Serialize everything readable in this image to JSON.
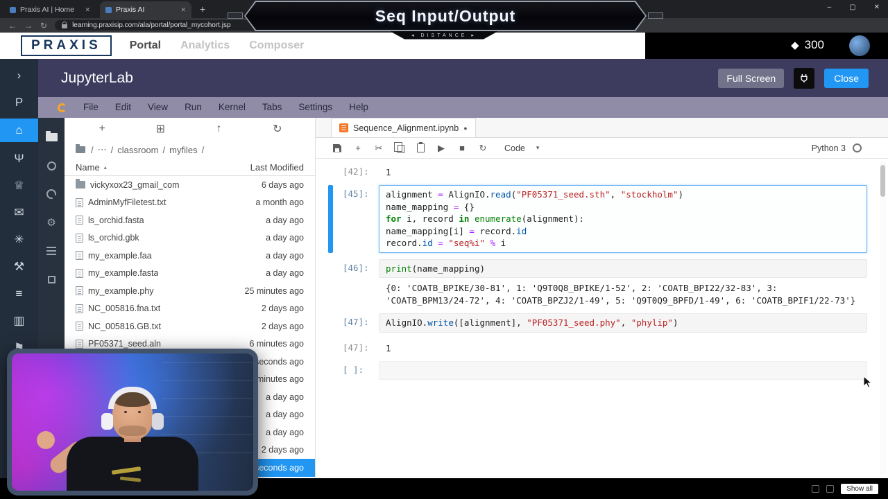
{
  "browser": {
    "tabs": [
      {
        "title": "Praxis AI | Home",
        "close_glyph": "✕"
      },
      {
        "title": "Praxis AI",
        "close_glyph": "✕"
      }
    ],
    "new_tab_glyph": "+",
    "nav": {
      "back": "←",
      "forward": "→",
      "reload": "↻"
    },
    "url": "learning.praxisip.com/ala/portal/portal_mycohort.jsp",
    "window_controls": [
      "–",
      "▢",
      "✕"
    ]
  },
  "stream_overlay": {
    "title": "Seq Input/Output",
    "subtitle": "◂ DISTANCE ▸"
  },
  "praxis": {
    "logo": "PRAXIS",
    "nav": [
      {
        "label": "Portal",
        "active": true
      },
      {
        "label": "Analytics",
        "active": false
      },
      {
        "label": "Composer",
        "active": false
      }
    ],
    "points": "300",
    "points_icon": "◆",
    "rail": [
      {
        "name": "chevron-right",
        "glyph": "›"
      },
      {
        "name": "praxis-p",
        "glyph": "P"
      },
      {
        "name": "home",
        "glyph": "⌂",
        "active": true
      },
      {
        "name": "branch",
        "glyph": "Ψ"
      },
      {
        "name": "trophy",
        "glyph": "♕"
      },
      {
        "name": "mail",
        "glyph": "✉"
      },
      {
        "name": "palette",
        "glyph": "✳"
      },
      {
        "name": "tools",
        "glyph": "⚒"
      },
      {
        "name": "list",
        "glyph": "≡"
      },
      {
        "name": "chart",
        "glyph": "▥"
      },
      {
        "name": "flag",
        "glyph": "⚑"
      },
      {
        "name": "close",
        "glyph": "×"
      }
    ]
  },
  "jupyter": {
    "title": "JupyterLab",
    "fullscreen_label": "Full Screen",
    "close_label": "Close",
    "menu": [
      "File",
      "Edit",
      "View",
      "Run",
      "Kernel",
      "Tabs",
      "Settings",
      "Help"
    ],
    "activity": [
      {
        "name": "file-browser",
        "shape": "folder",
        "active": true
      },
      {
        "name": "running-sessions",
        "shape": "ring"
      },
      {
        "name": "command-palette",
        "shape": "palette"
      },
      {
        "name": "property-inspector",
        "glyph": "⚙"
      },
      {
        "name": "open-tabs",
        "shape": "bars"
      },
      {
        "name": "extension-manager",
        "shape": "square"
      }
    ],
    "filebrowser": {
      "toolbar": [
        {
          "name": "new-launcher",
          "glyph": "+"
        },
        {
          "name": "new-folder",
          "glyph": "⊞"
        },
        {
          "name": "upload",
          "glyph": "↑"
        },
        {
          "name": "refresh",
          "glyph": "↻"
        }
      ],
      "breadcrumb": [
        {
          "label": "/"
        },
        {
          "label": "⋯"
        },
        {
          "label": "/"
        },
        {
          "label": "classroom"
        },
        {
          "label": "/"
        },
        {
          "label": "myfiles"
        },
        {
          "label": "/"
        }
      ],
      "columns": {
        "name": "Name",
        "modified": "Last Modified"
      },
      "sort_glyph": "▴",
      "files": [
        {
          "name": "vickyxox23_gmail_com",
          "modified": "6 days ago",
          "icon": "folder"
        },
        {
          "name": "AdminMyfFiletest.txt",
          "modified": "a month ago",
          "icon": "file"
        },
        {
          "name": "ls_orchid.fasta",
          "modified": "a day ago",
          "icon": "file"
        },
        {
          "name": "ls_orchid.gbk",
          "modified": "a day ago",
          "icon": "file"
        },
        {
          "name": "my_example.faa",
          "modified": "a day ago",
          "icon": "file"
        },
        {
          "name": "my_example.fasta",
          "modified": "a day ago",
          "icon": "file"
        },
        {
          "name": "my_example.phy",
          "modified": "25 minutes ago",
          "icon": "file"
        },
        {
          "name": "NC_005816.fna.txt",
          "modified": "2 days ago",
          "icon": "file"
        },
        {
          "name": "NC_005816.GB.txt",
          "modified": "2 days ago",
          "icon": "file"
        },
        {
          "name": "PF05371_seed.aln",
          "modified": "6 minutes ago",
          "icon": "file"
        },
        {
          "name": "",
          "modified": "seconds ago",
          "icon": "file"
        },
        {
          "name": "",
          "modified": "minutes ago",
          "icon": "file"
        },
        {
          "name": "",
          "modified": "a day ago",
          "icon": "file"
        },
        {
          "name": "",
          "modified": "a day ago",
          "icon": "file"
        },
        {
          "name": "",
          "modified": "a day ago",
          "icon": "file"
        },
        {
          "name": "",
          "modified": "2 days ago",
          "icon": "file"
        },
        {
          "name": "",
          "modified": "seconds ago",
          "icon": "file",
          "selected": true
        }
      ]
    },
    "notebook": {
      "tab_title": "Sequence_Alignment.ipynb",
      "dirty_glyph": "●",
      "toolbar": {
        "icons": [
          {
            "name": "save",
            "shape": "floppy"
          },
          {
            "name": "add-cell",
            "glyph": "+"
          },
          {
            "name": "cut-cell",
            "glyph": "✂"
          },
          {
            "name": "copy-cell",
            "shape": "copy"
          },
          {
            "name": "paste-cell",
            "shape": "paste"
          },
          {
            "name": "run-cell",
            "glyph": "▶"
          },
          {
            "name": "interrupt-kernel",
            "glyph": "■"
          },
          {
            "name": "restart-kernel",
            "glyph": "↻"
          }
        ],
        "cell_type": "Code",
        "caret": "▾",
        "kernel_name": "Python 3"
      },
      "cells": [
        {
          "kind": "output",
          "prompt": "[42]:",
          "text": "1"
        },
        {
          "kind": "code",
          "prompt": "[45]:",
          "selected": true,
          "lines": [
            [
              [
                "v",
                "alignment "
              ],
              [
                "op",
                "="
              ],
              [
                "v",
                " AlignIO."
              ],
              [
                "p",
                "read"
              ],
              [
                "v",
                "("
              ],
              [
                "s",
                "\"PF05371_seed.sth\""
              ],
              [
                "v",
                ", "
              ],
              [
                "s",
                "\"stockholm\""
              ],
              [
                "v",
                ")"
              ]
            ],
            [
              [
                "v",
                "name_mapping "
              ],
              [
                "op",
                "="
              ],
              [
                "v",
                " {}"
              ]
            ],
            [
              [
                "kw",
                "for"
              ],
              [
                "v",
                " i, record "
              ],
              [
                "kw",
                "in"
              ],
              [
                "v",
                " "
              ],
              [
                "b",
                "enumerate"
              ],
              [
                "v",
                "(alignment):"
              ]
            ],
            [
              [
                "v",
                "    name_mapping[i] "
              ],
              [
                "op",
                "="
              ],
              [
                "v",
                " record."
              ],
              [
                "p",
                "id"
              ]
            ],
            [
              [
                "v",
                "    record."
              ],
              [
                "p",
                "id"
              ],
              [
                "v",
                " "
              ],
              [
                "op",
                "="
              ],
              [
                "v",
                " "
              ],
              [
                "s",
                "\"seq%i\""
              ],
              [
                "v",
                " "
              ],
              [
                "op",
                "%"
              ],
              [
                "v",
                " i"
              ]
            ]
          ]
        },
        {
          "kind": "code",
          "prompt": "[46]:",
          "lines": [
            [
              [
                "b",
                "print"
              ],
              [
                "v",
                "(name_mapping)"
              ]
            ]
          ],
          "output": "{0: 'COATB_BPIKE/30-81', 1: 'Q9T0Q8_BPIKE/1-52', 2: 'COATB_BPI22/32-83', 3: 'COATB_BPM13/24-72', 4: 'COATB_BPZJ2/1-49', 5: 'Q9T0Q9_BPFD/1-49', 6: 'COATB_BPIF1/22-73'}"
        },
        {
          "kind": "code",
          "prompt": "[47]:",
          "lines": [
            [
              [
                "v",
                "AlignIO."
              ],
              [
                "p",
                "write"
              ],
              [
                "v",
                "([alignment], "
              ],
              [
                "s",
                "\"PF05371_seed.phy\""
              ],
              [
                "v",
                ", "
              ],
              [
                "s",
                "\"phylip\""
              ],
              [
                "v",
                ")"
              ]
            ]
          ]
        },
        {
          "kind": "output",
          "prompt": "[47]:",
          "text": "1"
        },
        {
          "kind": "code",
          "prompt": "[ ]:",
          "lines": []
        }
      ]
    }
  },
  "statusbar": {
    "show_all": "Show all"
  }
}
